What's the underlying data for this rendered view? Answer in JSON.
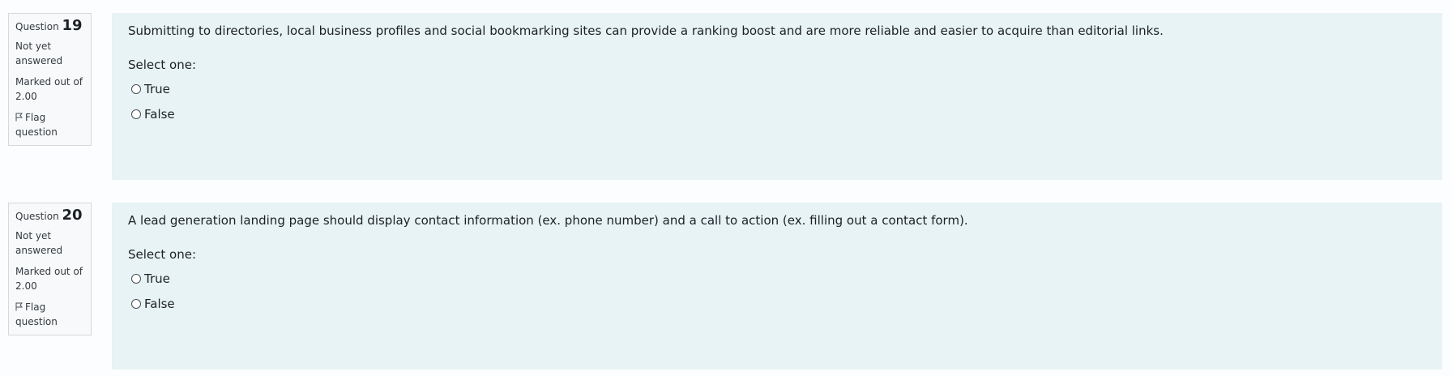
{
  "questions": [
    {
      "label": "Question",
      "number": "19",
      "state": "Not yet answered",
      "grade": "Marked out of 2.00",
      "flag_label": "Flag question",
      "text": "Submitting to directories, local business profiles and social bookmarking sites can provide a ranking boost and are more reliable and easier to acquire than editorial links.",
      "prompt": "Select one:",
      "options": [
        "True",
        "False"
      ]
    },
    {
      "label": "Question",
      "number": "20",
      "state": "Not yet answered",
      "grade": "Marked out of 2.00",
      "flag_label": "Flag question",
      "text": "A lead generation landing page should display contact information (ex. phone number) and a call to action (ex. filling out a contact form).",
      "prompt": "Select one:",
      "options": [
        "True",
        "False"
      ]
    }
  ],
  "icons": {
    "flag": "flag-icon",
    "radio": "radio-button-icon"
  },
  "colors": {
    "content_bg": "#e7f3f5",
    "info_bg": "#f8f9fa",
    "border": "#d5d8dc"
  }
}
